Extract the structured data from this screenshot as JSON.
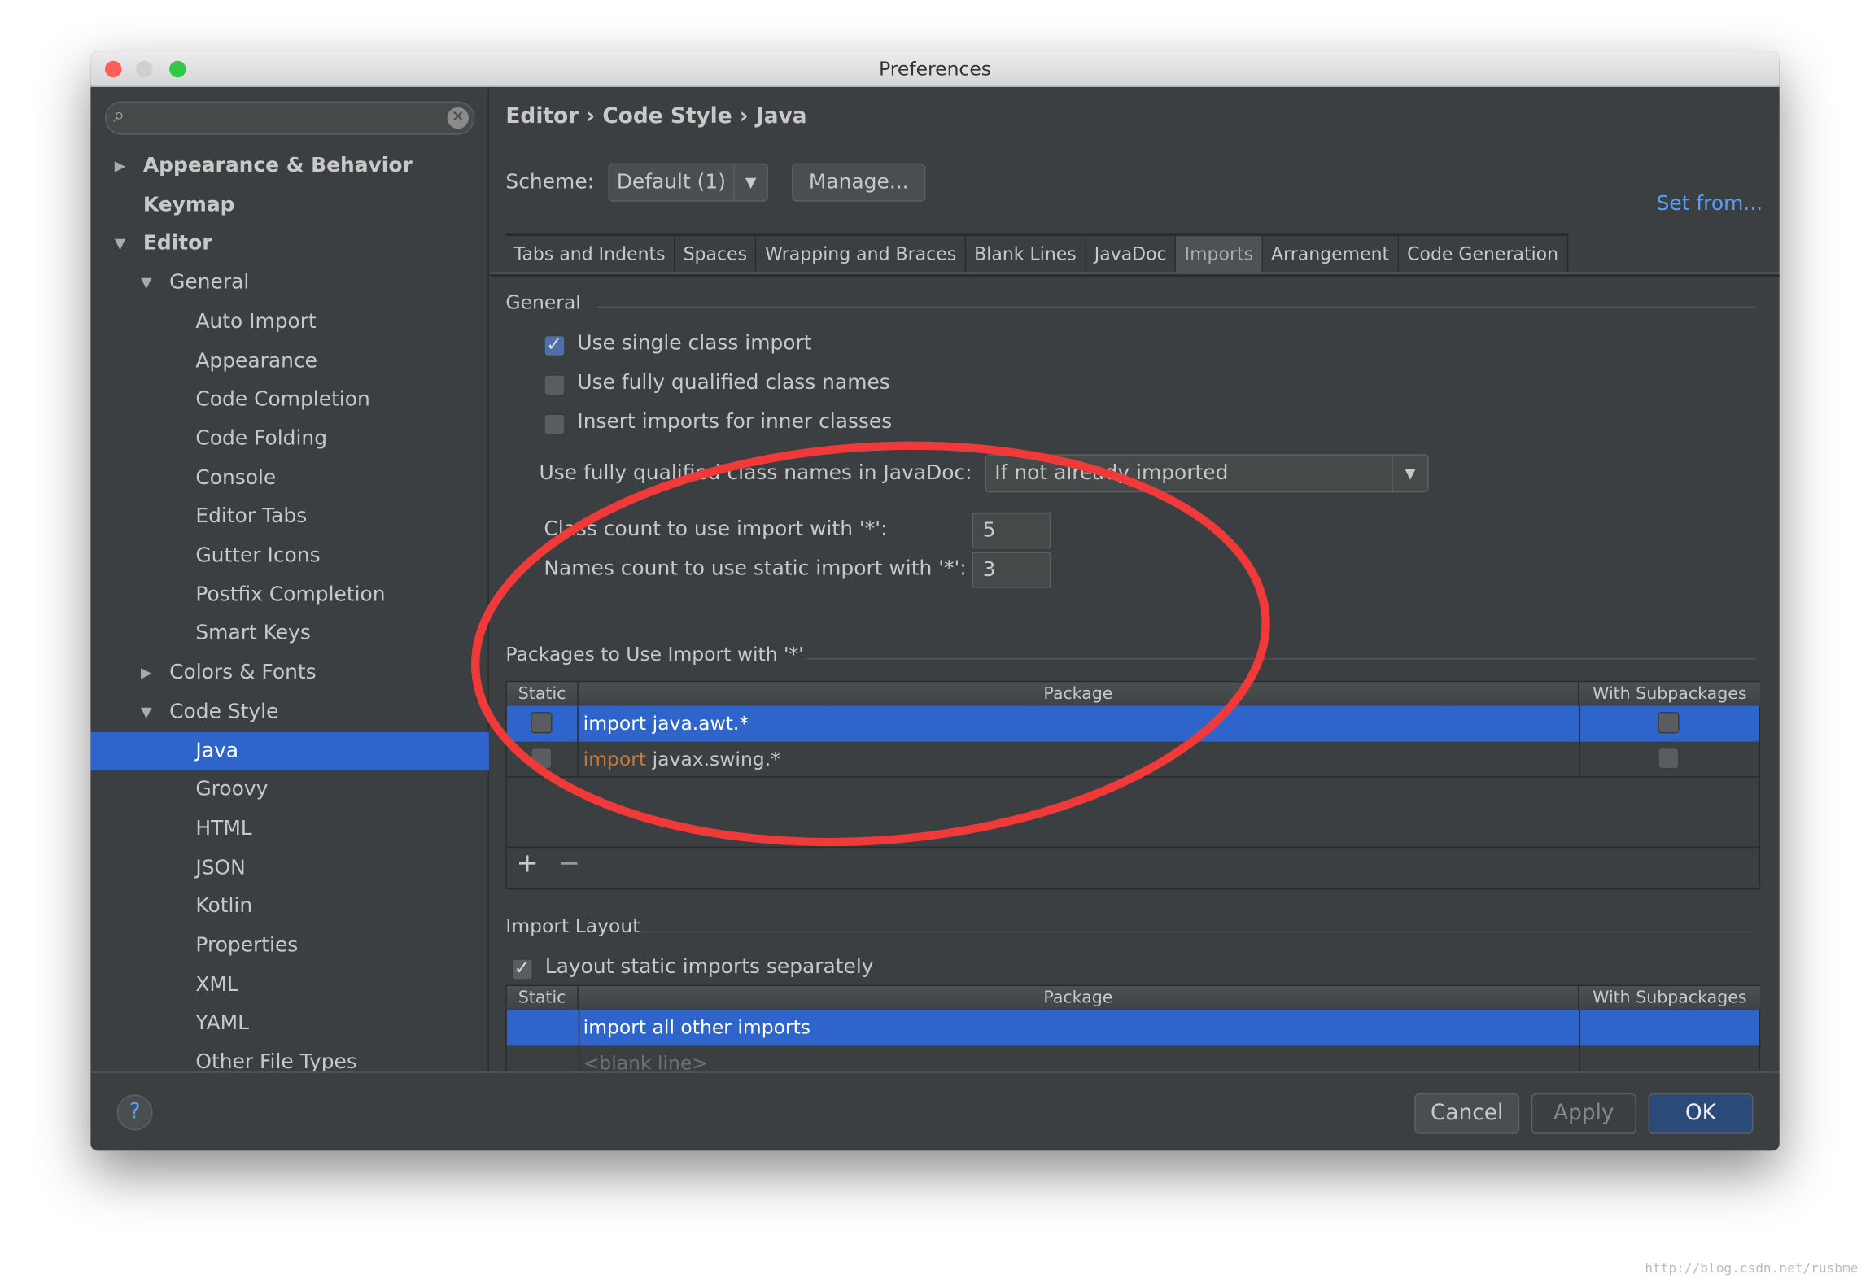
{
  "window": {
    "title": "Preferences"
  },
  "search": {
    "placeholder": ""
  },
  "sidebar": {
    "items": [
      {
        "label": "Appearance & Behavior",
        "level": 0,
        "arrow": "collapsed"
      },
      {
        "label": "Keymap",
        "level": 0,
        "arrow": ""
      },
      {
        "label": "Editor",
        "level": 0,
        "arrow": "expanded"
      },
      {
        "label": "General",
        "level": 1,
        "arrow": "expanded"
      },
      {
        "label": "Auto Import",
        "level": 2,
        "arrow": ""
      },
      {
        "label": "Appearance",
        "level": 2,
        "arrow": ""
      },
      {
        "label": "Code Completion",
        "level": 2,
        "arrow": ""
      },
      {
        "label": "Code Folding",
        "level": 2,
        "arrow": ""
      },
      {
        "label": "Console",
        "level": 2,
        "arrow": ""
      },
      {
        "label": "Editor Tabs",
        "level": 2,
        "arrow": ""
      },
      {
        "label": "Gutter Icons",
        "level": 2,
        "arrow": ""
      },
      {
        "label": "Postfix Completion",
        "level": 2,
        "arrow": ""
      },
      {
        "label": "Smart Keys",
        "level": 2,
        "arrow": ""
      },
      {
        "label": "Colors & Fonts",
        "level": 1,
        "arrow": "collapsed"
      },
      {
        "label": "Code Style",
        "level": 1,
        "arrow": "expanded"
      },
      {
        "label": "Java",
        "level": 2,
        "arrow": "",
        "selected": true
      },
      {
        "label": "Groovy",
        "level": 2,
        "arrow": ""
      },
      {
        "label": "HTML",
        "level": 2,
        "arrow": ""
      },
      {
        "label": "JSON",
        "level": 2,
        "arrow": ""
      },
      {
        "label": "Kotlin",
        "level": 2,
        "arrow": ""
      },
      {
        "label": "Properties",
        "level": 2,
        "arrow": ""
      },
      {
        "label": "XML",
        "level": 2,
        "arrow": ""
      },
      {
        "label": "YAML",
        "level": 2,
        "arrow": ""
      },
      {
        "label": "Other File Types",
        "level": 2,
        "arrow": ""
      }
    ]
  },
  "breadcrumb": {
    "a": "Editor",
    "b": "Code Style",
    "c": "Java",
    "sep": "›"
  },
  "scheme": {
    "label": "Scheme:",
    "value": "Default (1)",
    "manage": "Manage...",
    "set_from": "Set from..."
  },
  "tabs": [
    "Tabs and Indents",
    "Spaces",
    "Wrapping and Braces",
    "Blank Lines",
    "JavaDoc",
    "Imports",
    "Arrangement",
    "Code Generation"
  ],
  "active_tab": "Imports",
  "general": {
    "title": "General",
    "opt1": "Use single class import",
    "opt1_checked": true,
    "opt2": "Use fully qualified class names",
    "opt2_checked": false,
    "opt3": "Insert imports for inner classes",
    "opt3_checked": false,
    "javadoc_label": "Use fully qualified class names in JavaDoc:",
    "javadoc_value": "If not already imported",
    "class_count_label": "Class count to use import with '*':",
    "class_count": "5",
    "names_count_label": "Names count to use static import with '*':",
    "names_count": "3"
  },
  "packages": {
    "title": "Packages to Use Import with '*'",
    "headers": {
      "static": "Static",
      "package": "Package",
      "sub": "With Subpackages"
    },
    "rows": [
      {
        "kw": "import",
        "pkg": "java.awt.*"
      },
      {
        "kw": "import",
        "pkg": "javax.swing.*"
      }
    ],
    "add": "+",
    "remove": "−"
  },
  "layout": {
    "title": "Import Layout",
    "static_sep": "Layout static imports separately",
    "headers": {
      "static": "Static",
      "package": "Package",
      "sub": "With Subpackages"
    },
    "row1": "import all other imports",
    "row2": "<blank line>"
  },
  "footer": {
    "help": "?",
    "cancel": "Cancel",
    "apply": "Apply",
    "ok": "OK"
  },
  "watermark": "http://blog.csdn.net/rusbme",
  "colors": {
    "selection": "#2f65ca",
    "link": "#589df6",
    "annotation": "#f03a3a",
    "keyword": "#cc7832"
  }
}
